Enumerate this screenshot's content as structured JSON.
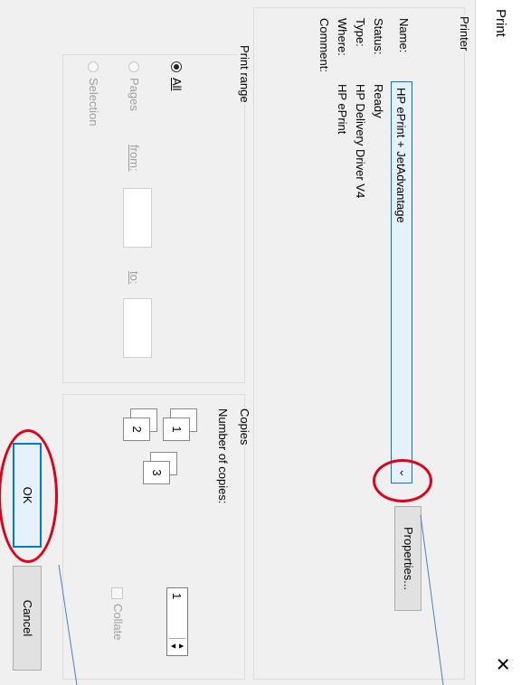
{
  "dialog": {
    "title": "Print",
    "close_glyph": "✕"
  },
  "printer": {
    "legend": "Printer",
    "name_label": "Name:",
    "name_value": "HP ePrint + JetAdvantage",
    "dropdown_arrow": "‹",
    "status_label": "Status:",
    "status_value": "Ready",
    "type_label": "Type:",
    "type_value": "HP Delivery Driver V4",
    "where_label": "Where:",
    "where_value": "HP ePrint",
    "comment_label": "Comment:",
    "properties_button": "Properties..."
  },
  "print_range": {
    "legend": "Print range",
    "all_label": "All",
    "pages_label": "Pages",
    "from_label": "from:",
    "to_label": "to:",
    "selection_label": "Selection",
    "selected": "All"
  },
  "copies": {
    "legend": "Copies",
    "number_label": "Number of copies:",
    "number_value": "1",
    "collate_label": "Collate",
    "collate_checked": false,
    "page_glyphs": [
      "1",
      "1",
      "2",
      "2",
      "3",
      "3"
    ]
  },
  "buttons": {
    "ok": "OK",
    "cancel": "Cancel"
  },
  "annotations": {
    "color": "#e0001a",
    "leader_color": "#4a7fc1"
  }
}
